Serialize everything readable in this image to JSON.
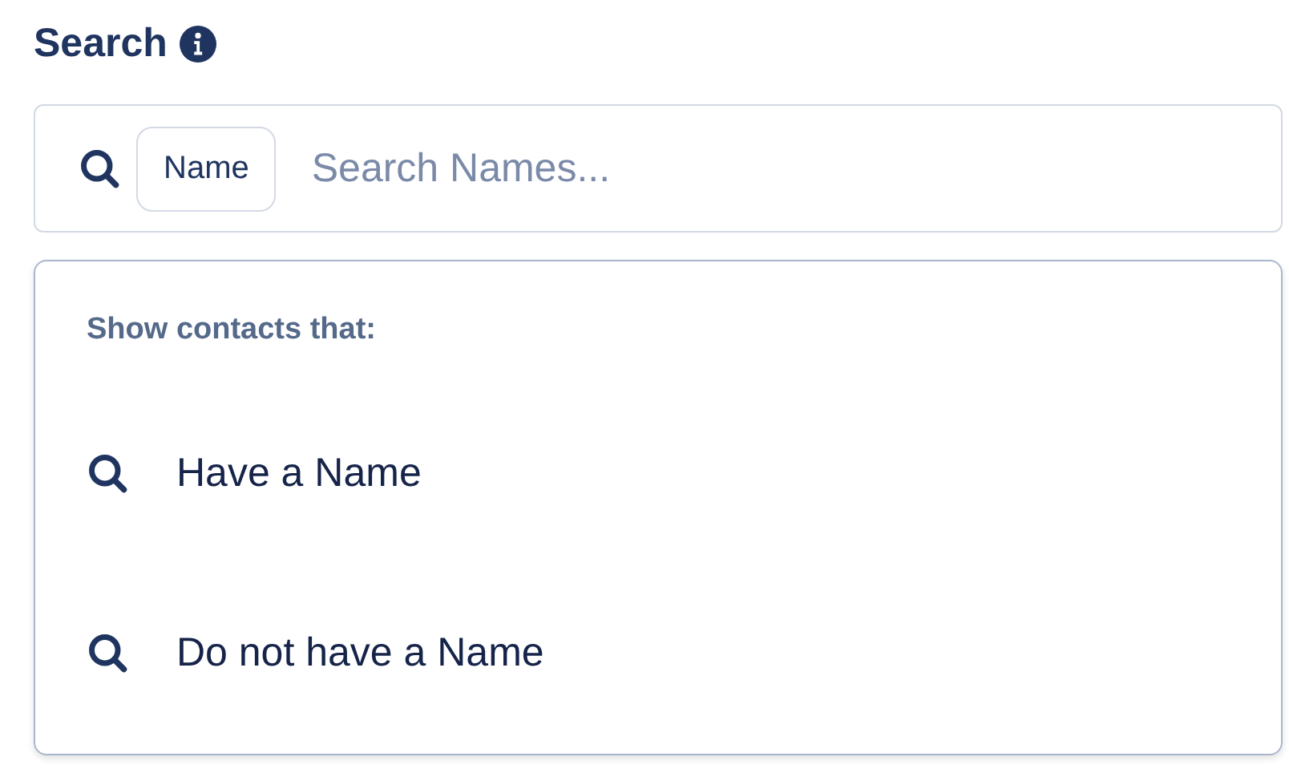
{
  "title": "Search",
  "search": {
    "filter_chip": "Name",
    "placeholder": "Search Names..."
  },
  "dropdown": {
    "heading": "Show contacts that:",
    "options": [
      {
        "label": "Have a Name"
      },
      {
        "label": "Do not have a Name"
      }
    ]
  }
}
